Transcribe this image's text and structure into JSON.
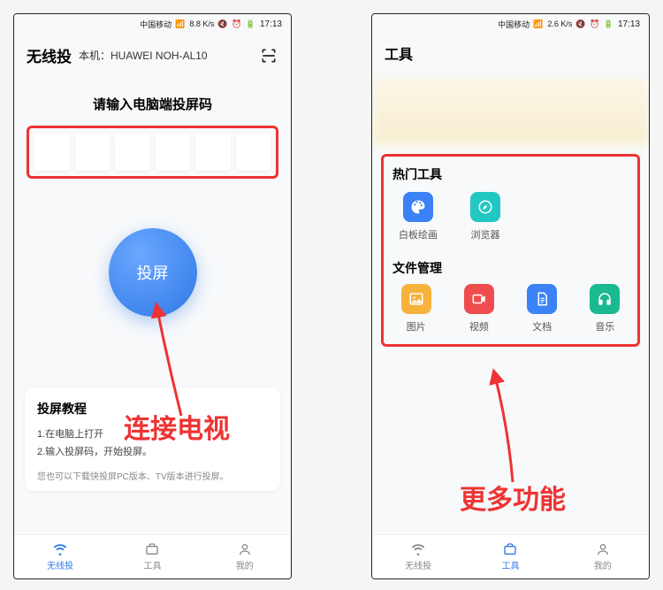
{
  "left": {
    "status": {
      "carrier": "中国移动",
      "rate": "8.8 K/s",
      "time": "17:13"
    },
    "header": {
      "title": "无线投",
      "device_label": "本机：",
      "device_name": "HUAWEI NOH-AL10"
    },
    "code_prompt": "请输入电脑端投屏码",
    "cast_button": "投屏",
    "tutorial": {
      "title": "投屏教程",
      "line1": "1.在电脑上打开",
      "line2": "2.输入投屏码，开始投屏。",
      "hint": "您也可以下载快投屏PC版本、TV版本进行投屏。"
    },
    "nav": [
      {
        "label": "无线投",
        "active": true
      },
      {
        "label": "工具",
        "active": false
      },
      {
        "label": "我的",
        "active": false
      }
    ]
  },
  "right": {
    "status": {
      "carrier": "中国移动",
      "rate": "2.6 K/s",
      "time": "17:13"
    },
    "header": {
      "title": "工具"
    },
    "hot_tools_title": "热门工具",
    "hot_tools": [
      {
        "label": "白板绘画"
      },
      {
        "label": "浏览器"
      }
    ],
    "file_mgmt_title": "文件管理",
    "file_tools": [
      {
        "label": "图片"
      },
      {
        "label": "视频"
      },
      {
        "label": "文档"
      },
      {
        "label": "音乐"
      }
    ],
    "nav": [
      {
        "label": "无线投",
        "active": false
      },
      {
        "label": "工具",
        "active": true
      },
      {
        "label": "我的",
        "active": false
      }
    ]
  },
  "annotations": {
    "a1": "连接电视",
    "a2": "更多功能"
  }
}
